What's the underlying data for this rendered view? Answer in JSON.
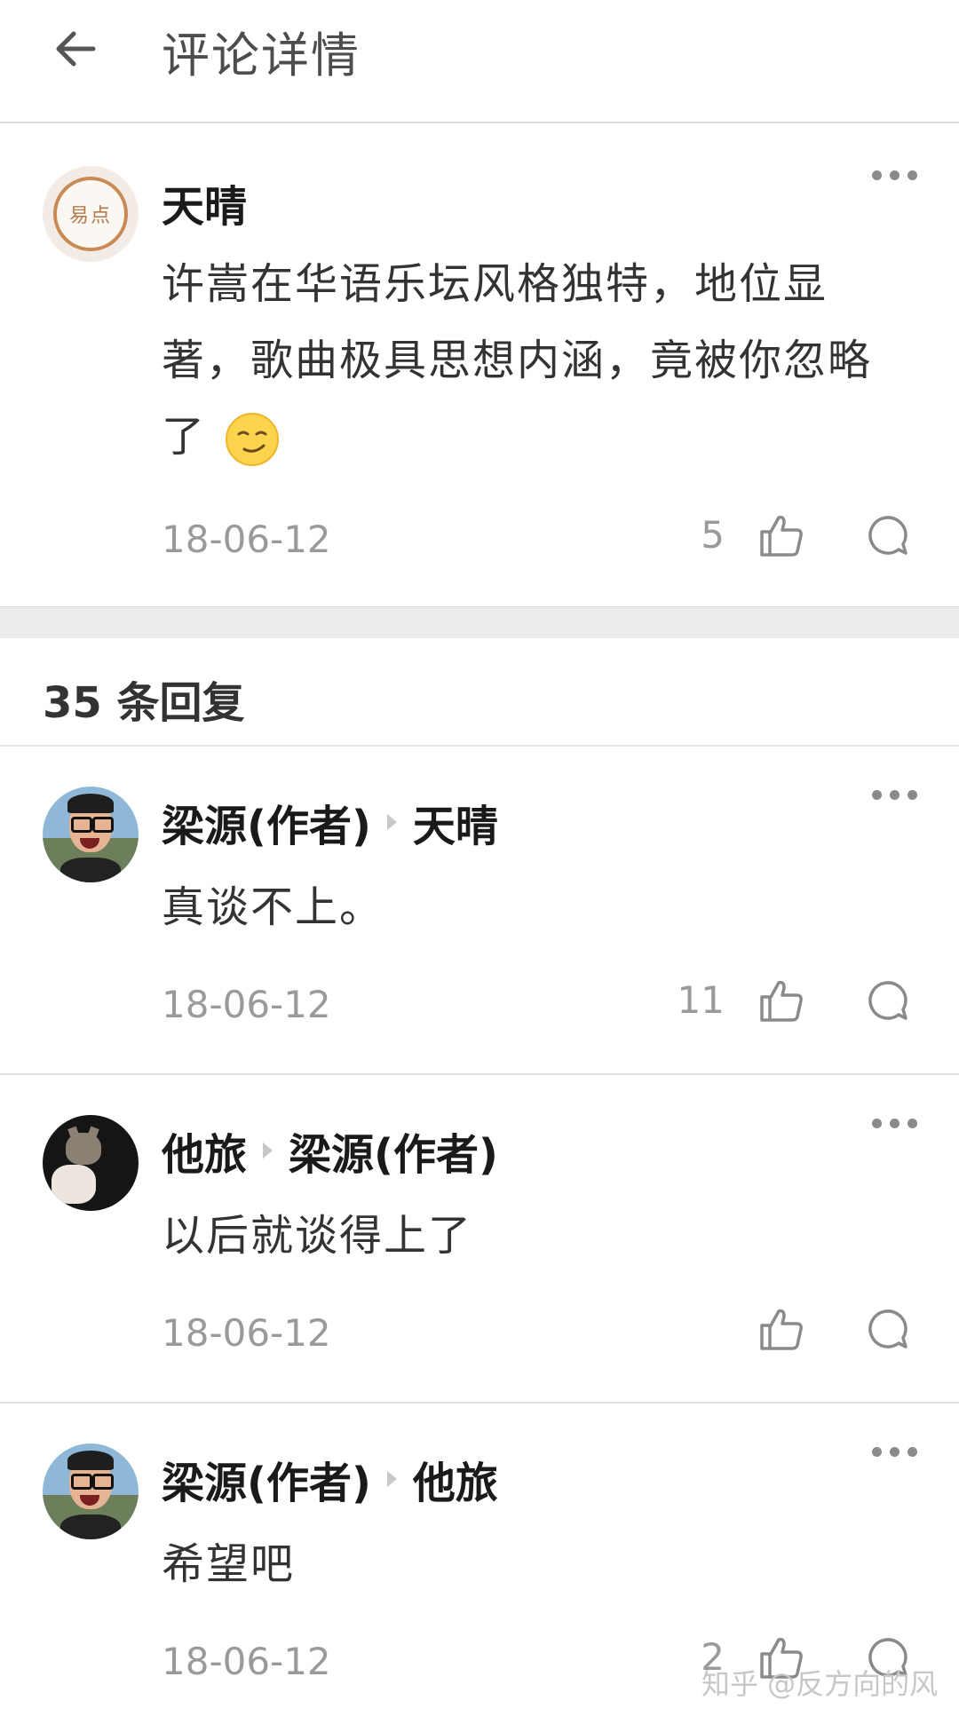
{
  "header": {
    "title": "评论详情"
  },
  "main_comment": {
    "avatar_text": "易点",
    "author": "天晴",
    "text": "许嵩在华语乐坛风格独特，地位显著，歌曲极具思想内涵，竟被你忽略了",
    "emoji": "smirk-emoji",
    "date": "18-06-12",
    "likes": "5"
  },
  "replies_header": {
    "count_label": "35 条回复"
  },
  "replies": [
    {
      "author": "梁源(作者)",
      "reply_to": "天晴",
      "text": "真谈不上。",
      "date": "18-06-12",
      "likes": "11"
    },
    {
      "author": "他旅",
      "reply_to": "梁源(作者)",
      "text": "以后就谈得上了",
      "date": "18-06-12",
      "likes": ""
    },
    {
      "author": "梁源(作者)",
      "reply_to": "他旅",
      "text": "希望吧",
      "date": "18-06-12",
      "likes": "2"
    }
  ],
  "watermark": "知乎 @反方向的风",
  "colors": {
    "accent_avatar": "#c98a55",
    "secondary_text": "#9a9a9a",
    "gap": "#ededed"
  }
}
